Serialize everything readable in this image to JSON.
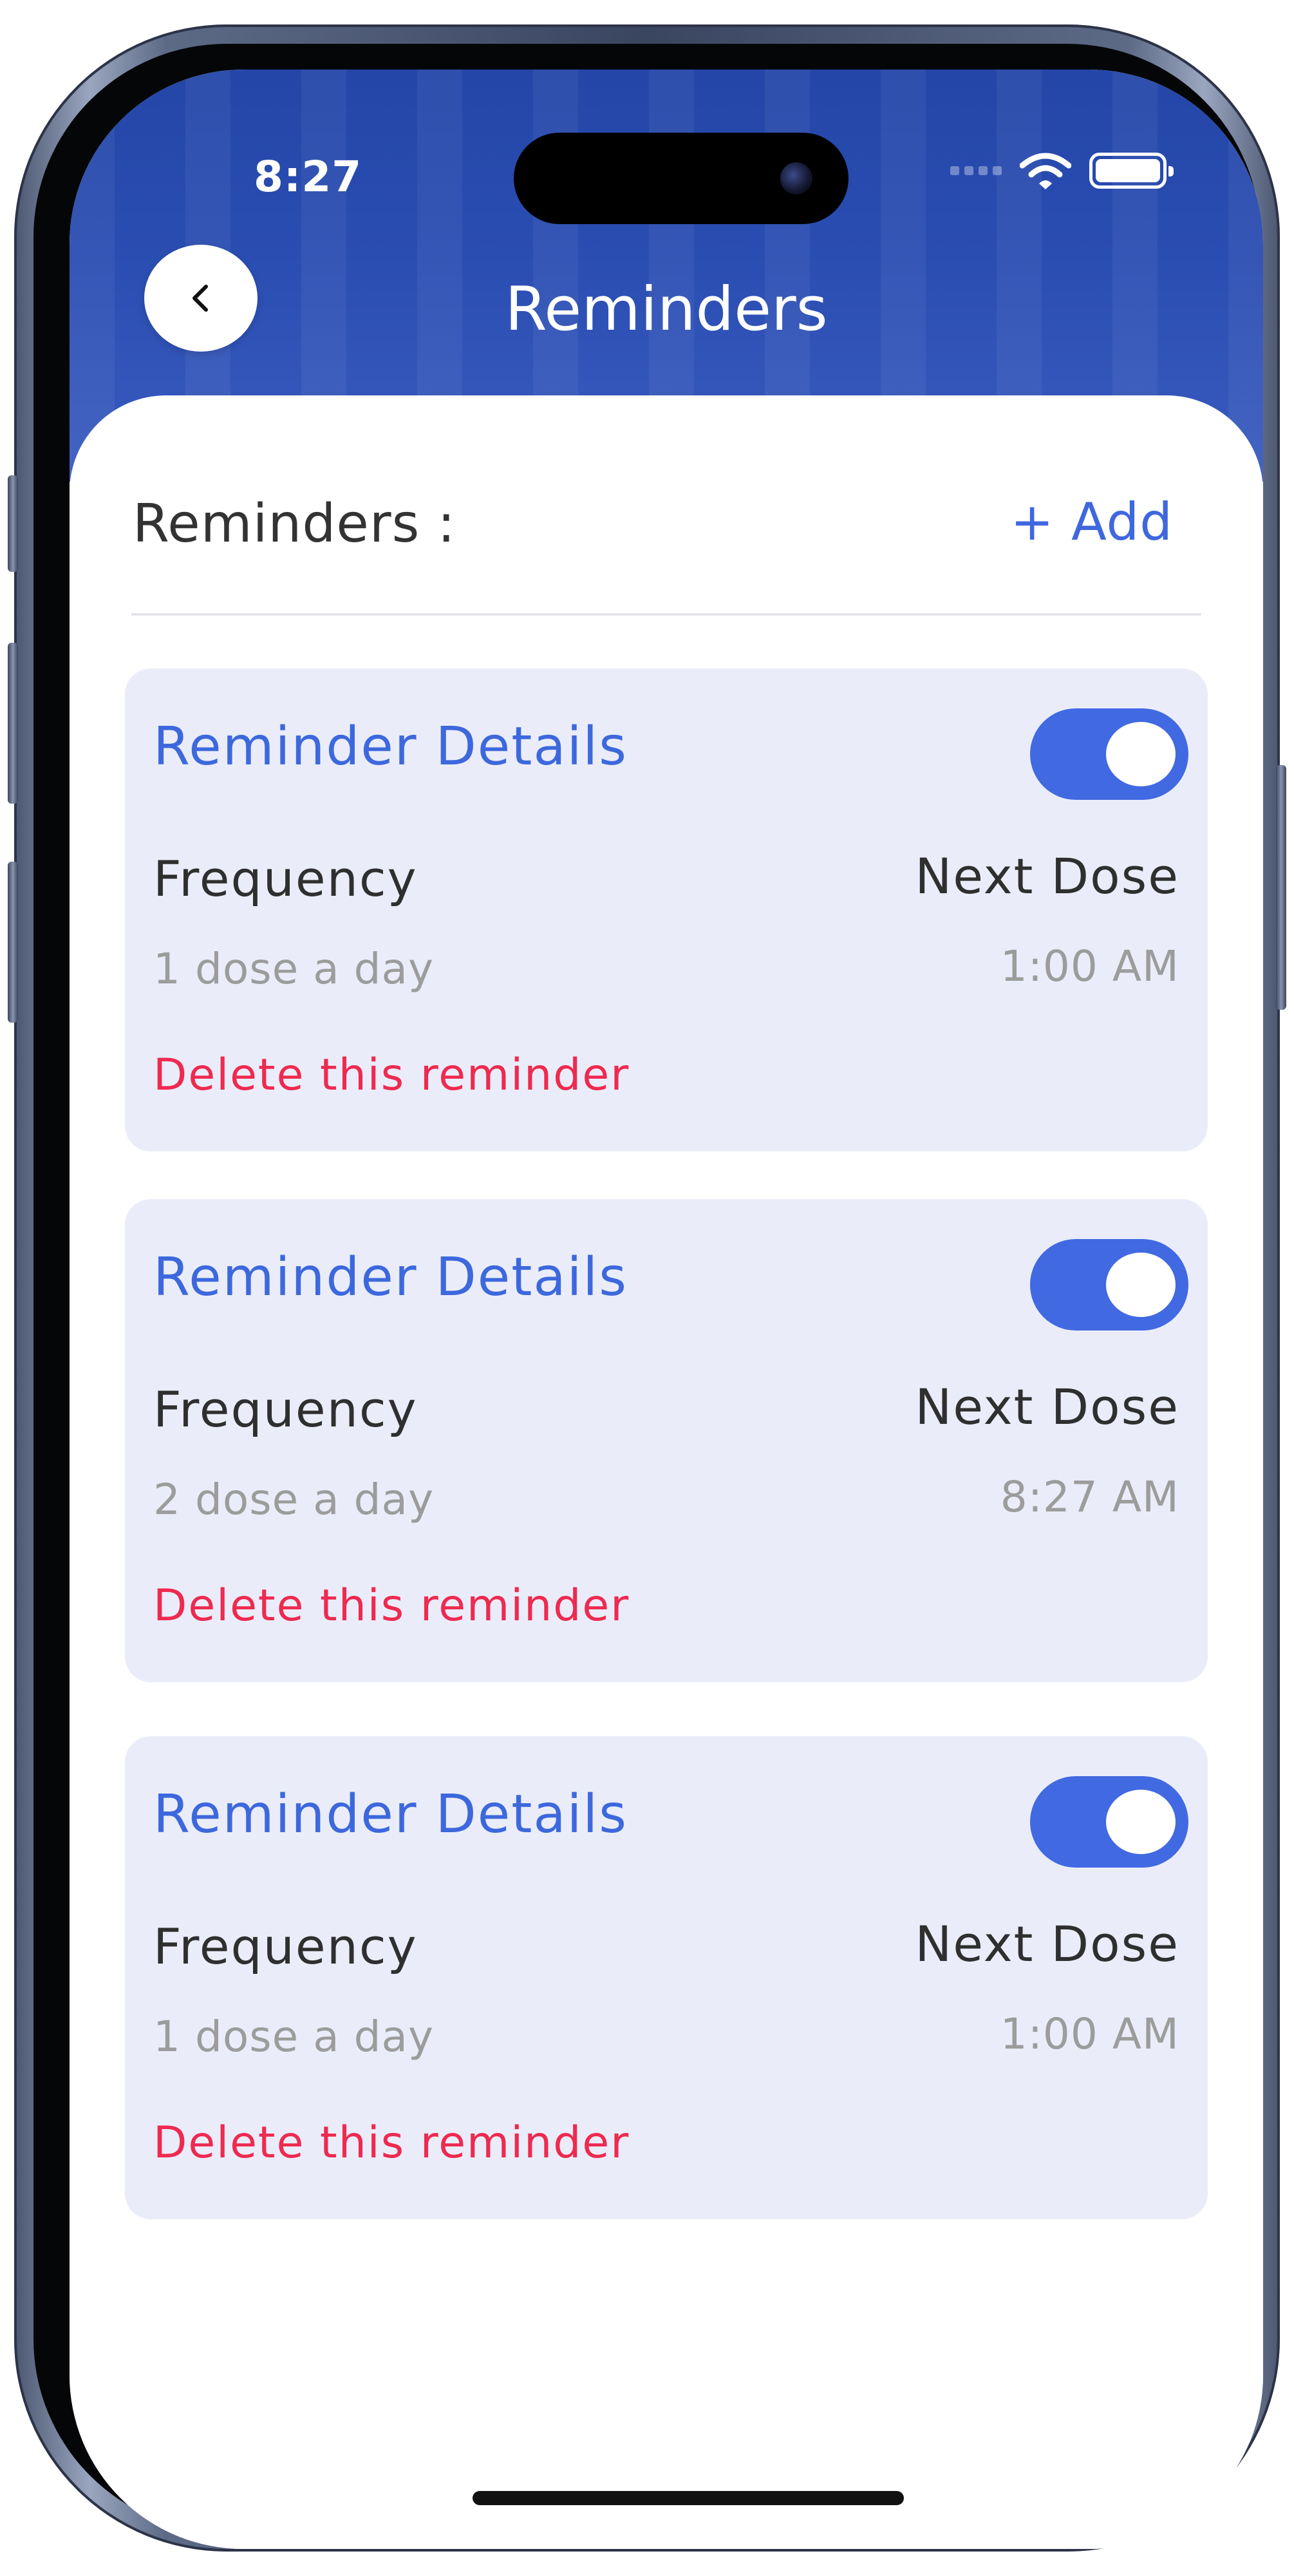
{
  "status_bar": {
    "time": "8:27"
  },
  "header": {
    "title": "Reminders",
    "back_icon": "chevron-left-icon"
  },
  "section": {
    "title": "Reminders :",
    "add_label": "+ Add"
  },
  "colors": {
    "header_blue": "#2a4db2",
    "accent_blue": "#3f67de",
    "toggle_blue": "#4169e1",
    "card_bg": "#eaedf9",
    "delete_red": "#ee2a50"
  },
  "reminders": [
    {
      "title": "Reminder Details",
      "enabled": true,
      "frequency_label": "Frequency",
      "frequency": "1 dose a day",
      "next_dose_label": "Next Dose",
      "next_dose": "1:00 AM",
      "delete_label": "Delete this reminder"
    },
    {
      "title": "Reminder Details",
      "enabled": true,
      "frequency_label": "Frequency",
      "frequency": "2 dose a day",
      "next_dose_label": "Next Dose",
      "next_dose": "8:27 AM",
      "delete_label": "Delete this reminder"
    },
    {
      "title": "Reminder Details",
      "enabled": true,
      "frequency_label": "Frequency",
      "frequency": "1 dose a day",
      "next_dose_label": "Next Dose",
      "next_dose": "1:00 AM",
      "delete_label": "Delete this reminder"
    }
  ]
}
